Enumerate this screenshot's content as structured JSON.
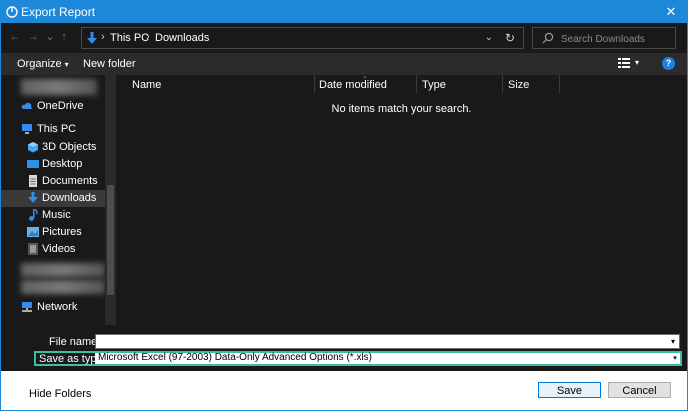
{
  "window": {
    "title": "Export Report",
    "close_glyph": "✕"
  },
  "address": {
    "crumbs": [
      "This PC",
      "Downloads"
    ],
    "separator": "›",
    "chevron": "⌄",
    "refresh": "↻"
  },
  "search": {
    "placeholder": "Search Downloads"
  },
  "toolbar": {
    "organize": "Organize",
    "dropdown": "▾",
    "new_folder": "New folder",
    "help": "?"
  },
  "sidebar": {
    "items": [
      {
        "label": "OneDrive",
        "icon": "cloud-icon"
      },
      {
        "label": "This PC",
        "icon": "computer-icon"
      },
      {
        "label": "3D Objects",
        "icon": "cube-icon"
      },
      {
        "label": "Desktop",
        "icon": "desktop-icon"
      },
      {
        "label": "Documents",
        "icon": "document-icon"
      },
      {
        "label": "Downloads",
        "icon": "download-icon",
        "selected": true
      },
      {
        "label": "Music",
        "icon": "music-icon"
      },
      {
        "label": "Pictures",
        "icon": "picture-icon"
      },
      {
        "label": "Videos",
        "icon": "video-icon"
      },
      {
        "label": "Network",
        "icon": "network-icon"
      }
    ]
  },
  "columns": [
    "Name",
    "Date modified",
    "Type",
    "Size"
  ],
  "empty_message": "No items match your search.",
  "file_name": {
    "label": "File name:",
    "value": ""
  },
  "save_as_type": {
    "label": "Save as type:",
    "value": "Microsoft Excel (97-2003) Data-Only Advanced Options (*.xls)"
  },
  "footer": {
    "hide_folders": "Hide Folders",
    "save": "Save",
    "cancel": "Cancel"
  },
  "colors": {
    "accent": "#1e88d8",
    "highlight": "#3abf9f",
    "background": "#191919"
  }
}
